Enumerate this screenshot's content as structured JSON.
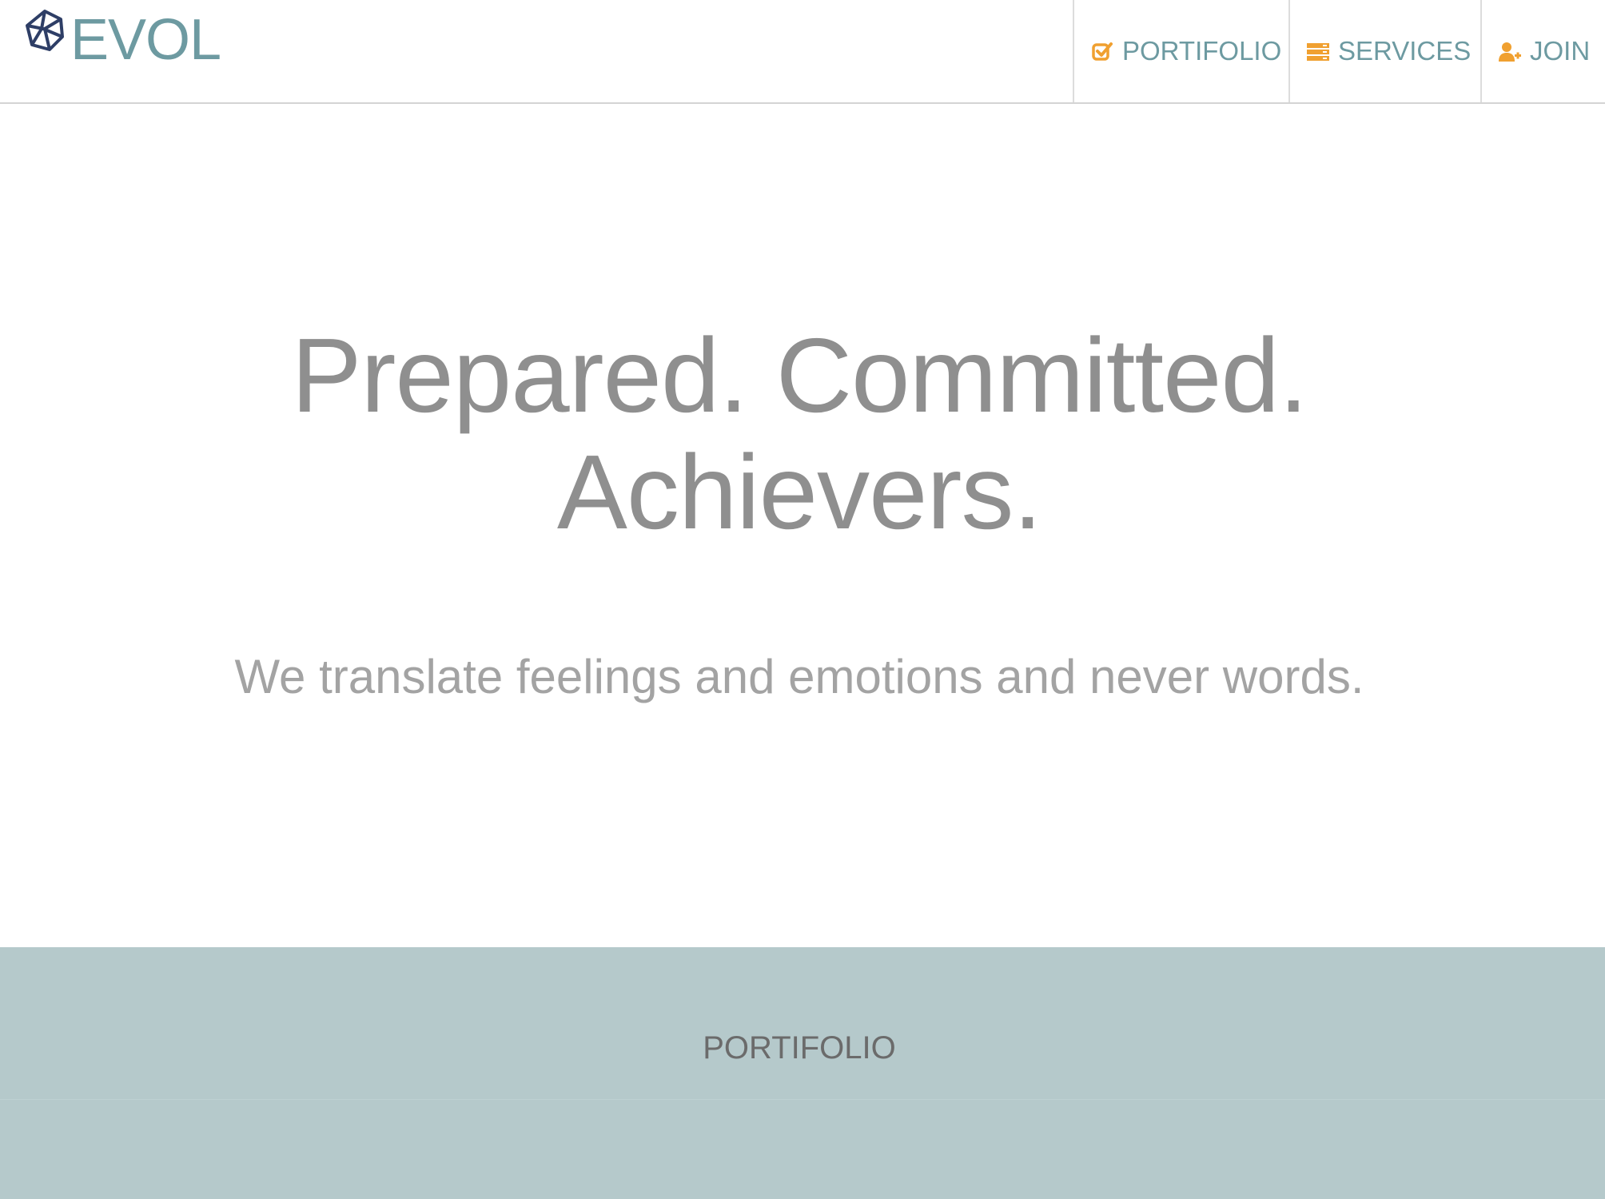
{
  "brand": {
    "name": "EVOL",
    "logo_icon": "star-hexagon-logo-icon"
  },
  "nav": {
    "items": [
      {
        "label": "PORTIFOLIO",
        "icon": "checkbox-icon"
      },
      {
        "label": "SERVICES",
        "icon": "server-icon"
      },
      {
        "label": "JOIN",
        "icon": "user-plus-icon"
      }
    ]
  },
  "hero": {
    "title_line1": "Prepared. Committed.",
    "title_line2": "Achievers.",
    "subtitle": "We translate feelings and emotions and never words."
  },
  "portfolio": {
    "heading": "PORTIFOLIO"
  },
  "colors": {
    "brand": "#6d9aa1",
    "accent_icon": "#f0a030",
    "logo": "#2e3e66",
    "hero_text": "#8f8f8f",
    "band_background": "#b5c9cb"
  }
}
